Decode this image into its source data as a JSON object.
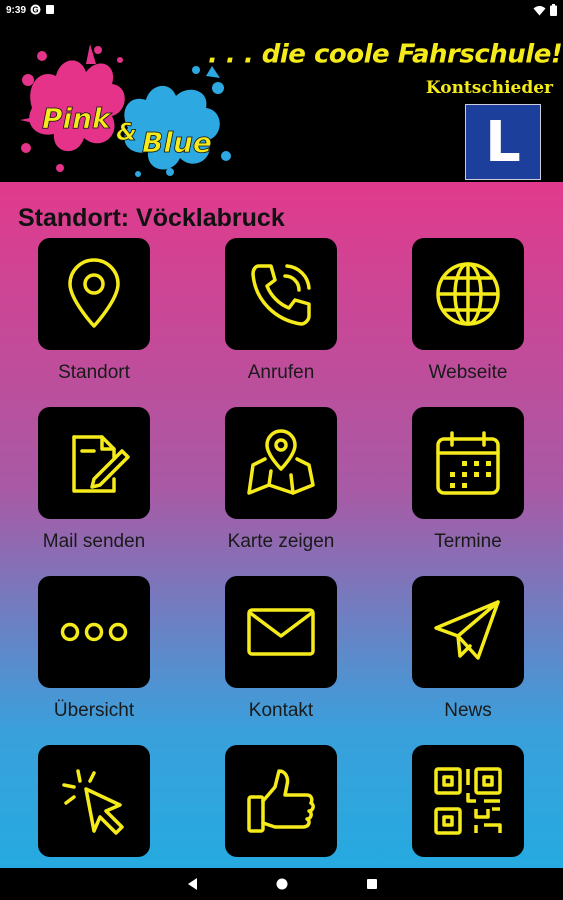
{
  "status_bar": {
    "time": "9:39",
    "left_icons": [
      "g-icon",
      "notification-icon"
    ],
    "right_icons": [
      "wifi-icon",
      "battery-icon"
    ]
  },
  "header": {
    "logo_text_pink": "Pink",
    "logo_ampersand": "&",
    "logo_text_blue": "Blue",
    "slogan": ". . . die coole Fahrschule!",
    "registered": "®",
    "brand_name": "Kontschieder",
    "badge_letter": "L",
    "colors": {
      "yellow": "#f5ea1a",
      "pink": "#e5338a",
      "blue": "#2ea8e0",
      "badge_blue": "#1b3f9a"
    }
  },
  "main": {
    "location_title": "Standort: Vöcklabruck",
    "tiles": [
      {
        "label": "Standort",
        "icon": "location-pin-icon"
      },
      {
        "label": "Anrufen",
        "icon": "phone-icon"
      },
      {
        "label": "Webseite",
        "icon": "globe-icon"
      },
      {
        "label": "Mail senden",
        "icon": "edit-document-icon"
      },
      {
        "label": "Karte zeigen",
        "icon": "map-icon"
      },
      {
        "label": "Termine",
        "icon": "calendar-icon"
      },
      {
        "label": "Übersicht",
        "icon": "more-dots-icon"
      },
      {
        "label": "Kontakt",
        "icon": "envelope-icon"
      },
      {
        "label": "News",
        "icon": "paper-plane-icon"
      },
      {
        "label": "",
        "icon": "cursor-click-icon"
      },
      {
        "label": "",
        "icon": "thumbs-up-icon"
      },
      {
        "label": "",
        "icon": "qr-code-icon"
      }
    ],
    "icon_color": "#f5ea1a"
  },
  "nav_bar": {
    "buttons": [
      "back-icon",
      "home-icon",
      "recents-icon"
    ]
  }
}
